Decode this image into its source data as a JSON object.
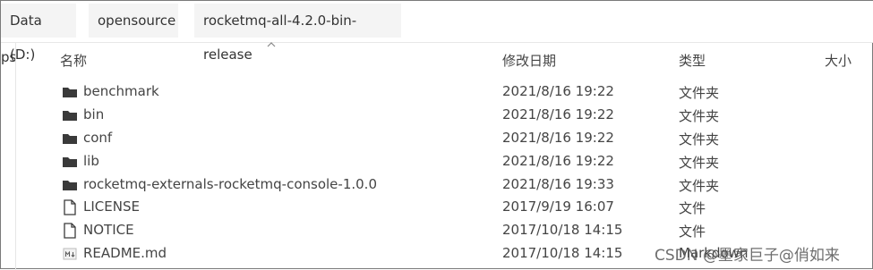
{
  "breadcrumb": [
    "Data (D:)",
    "opensource",
    "rocketmq-all-4.2.0-bin-release"
  ],
  "left_nav_clipped": "ps",
  "columns": {
    "name": "名称",
    "date": "修改日期",
    "type": "类型",
    "size": "大小"
  },
  "files": [
    {
      "name": "benchmark",
      "date": "2021/8/16 19:22",
      "type": "文件夹",
      "icon": "folder-icon"
    },
    {
      "name": "bin",
      "date": "2021/8/16 19:22",
      "type": "文件夹",
      "icon": "folder-icon"
    },
    {
      "name": "conf",
      "date": "2021/8/16 19:22",
      "type": "文件夹",
      "icon": "folder-icon"
    },
    {
      "name": "lib",
      "date": "2021/8/16 19:22",
      "type": "文件夹",
      "icon": "folder-icon"
    },
    {
      "name": "rocketmq-externals-rocketmq-console-1.0.0",
      "date": "2021/8/16 19:33",
      "type": "文件夹",
      "icon": "folder-icon"
    },
    {
      "name": "LICENSE",
      "date": "2017/9/19 16:07",
      "type": "文件",
      "icon": "file-icon"
    },
    {
      "name": "NOTICE",
      "date": "2017/10/18 14:15",
      "type": "文件",
      "icon": "file-icon"
    },
    {
      "name": "README.md",
      "date": "2017/10/18 14:15",
      "type": "Markdown",
      "icon": "markdown-file-icon"
    }
  ],
  "watermark": "CSDN @墨家巨子@俏如来"
}
